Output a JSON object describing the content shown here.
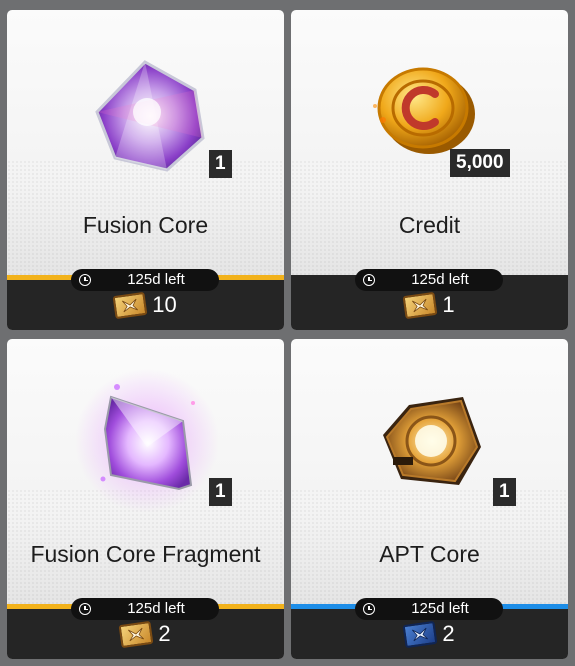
{
  "items": [
    {
      "name": "Fusion Core",
      "quantity": "1",
      "time_left": "125d left",
      "cost": "10",
      "cost_icon": "gold-ticket-icon",
      "bar_color": "#f2b21b"
    },
    {
      "name": "Credit",
      "quantity": "5,000",
      "time_left": "125d left",
      "cost": "1",
      "cost_icon": "gold-ticket-icon",
      "bar_color": "#f2b21b"
    },
    {
      "name": "Fusion Core Fragment",
      "quantity": "1",
      "time_left": "125d left",
      "cost": "2",
      "cost_icon": "gold-ticket-icon",
      "bar_color": "#f2b21b"
    },
    {
      "name": "APT Core",
      "quantity": "1",
      "time_left": "125d left",
      "cost": "2",
      "cost_icon": "blue-ticket-icon",
      "bar_color": "#1e8ee8"
    }
  ]
}
